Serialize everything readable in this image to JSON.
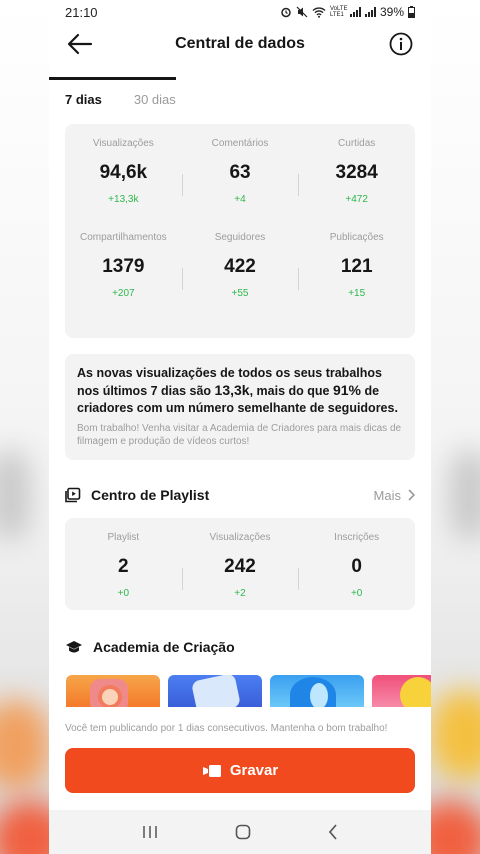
{
  "status": {
    "time": "21:10",
    "battery": "39%",
    "network": "VoLTE LTE1"
  },
  "header": {
    "title": "Central de dados"
  },
  "tabs": [
    {
      "label": "7 dias",
      "active": true
    },
    {
      "label": "30 dias",
      "active": false
    }
  ],
  "stats": [
    {
      "label": "Visualizações",
      "value": "94,6k",
      "delta": "+13,3k"
    },
    {
      "label": "Comentários",
      "value": "63",
      "delta": "+4"
    },
    {
      "label": "Curtidas",
      "value": "3284",
      "delta": "+472"
    },
    {
      "label": "Compartilhamentos",
      "value": "1379",
      "delta": "+207"
    },
    {
      "label": "Seguidores",
      "value": "422",
      "delta": "+55"
    },
    {
      "label": "Publicações",
      "value": "121",
      "delta": "+15"
    }
  ],
  "summary": {
    "part1": "As novas visualizações de todos os seus trabalhos nos últimos 7 dias são ",
    "value": "13,3k",
    "part2": ", mais do que ",
    "percent": "91%",
    "part3": " de criadores com um número semelhante de seguidores.",
    "note": "Bom trabalho! Venha visitar a Academia de Criadores para mais dicas de filmagem e produção de vídeos curtos!"
  },
  "playlist": {
    "title": "Centro de Playlist",
    "more": "Mais",
    "stats": [
      {
        "label": "Playlist",
        "value": "2",
        "delta": "+0"
      },
      {
        "label": "Visualizações",
        "value": "242",
        "delta": "+2"
      },
      {
        "label": "Inscrições",
        "value": "0",
        "delta": "+0"
      }
    ]
  },
  "academy": {
    "title": "Academia de Criação"
  },
  "streak": "Você tem publicando por 1 dias consecutivos. Mantenha o bom trabalho!",
  "record_button": "Gravar",
  "colors": {
    "accent": "#f04a1e",
    "positive": "#2db84d",
    "card": "#f3f3f3"
  }
}
